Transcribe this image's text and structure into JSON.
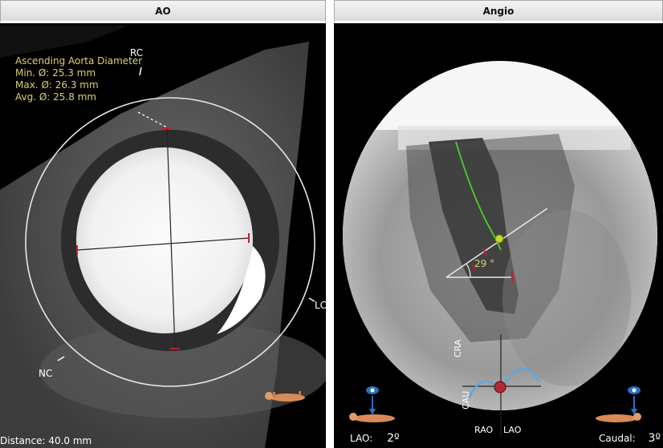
{
  "ao_panel": {
    "title": "AO",
    "measurement": {
      "heading": "Ascending Aorta Diameter",
      "min": "Min. Ø: 25.3 mm",
      "max": "Max. Ø: 26.3 mm",
      "avg": "Avg. Ø: 25.8 mm"
    },
    "labels": {
      "rc": "RC",
      "lc": "LC",
      "nc": "NC"
    },
    "distance": "Distance: 40.0 mm"
  },
  "angio_panel": {
    "title": "Angio",
    "angle_value": "29 °",
    "orientation": {
      "cra": "CRA",
      "cau": "CAU",
      "rao": "RAO",
      "lao": "LAO"
    },
    "lao_label": "LAO:",
    "lao_value": "2º",
    "caudal_label": "Caudal:",
    "caudal_value": "3º"
  },
  "colors": {
    "overlay_text": "#d9d36a",
    "marker_red": "#c0202a",
    "centerline_green": "#4ccf2a",
    "arc_blue": "#5aa8e8"
  }
}
